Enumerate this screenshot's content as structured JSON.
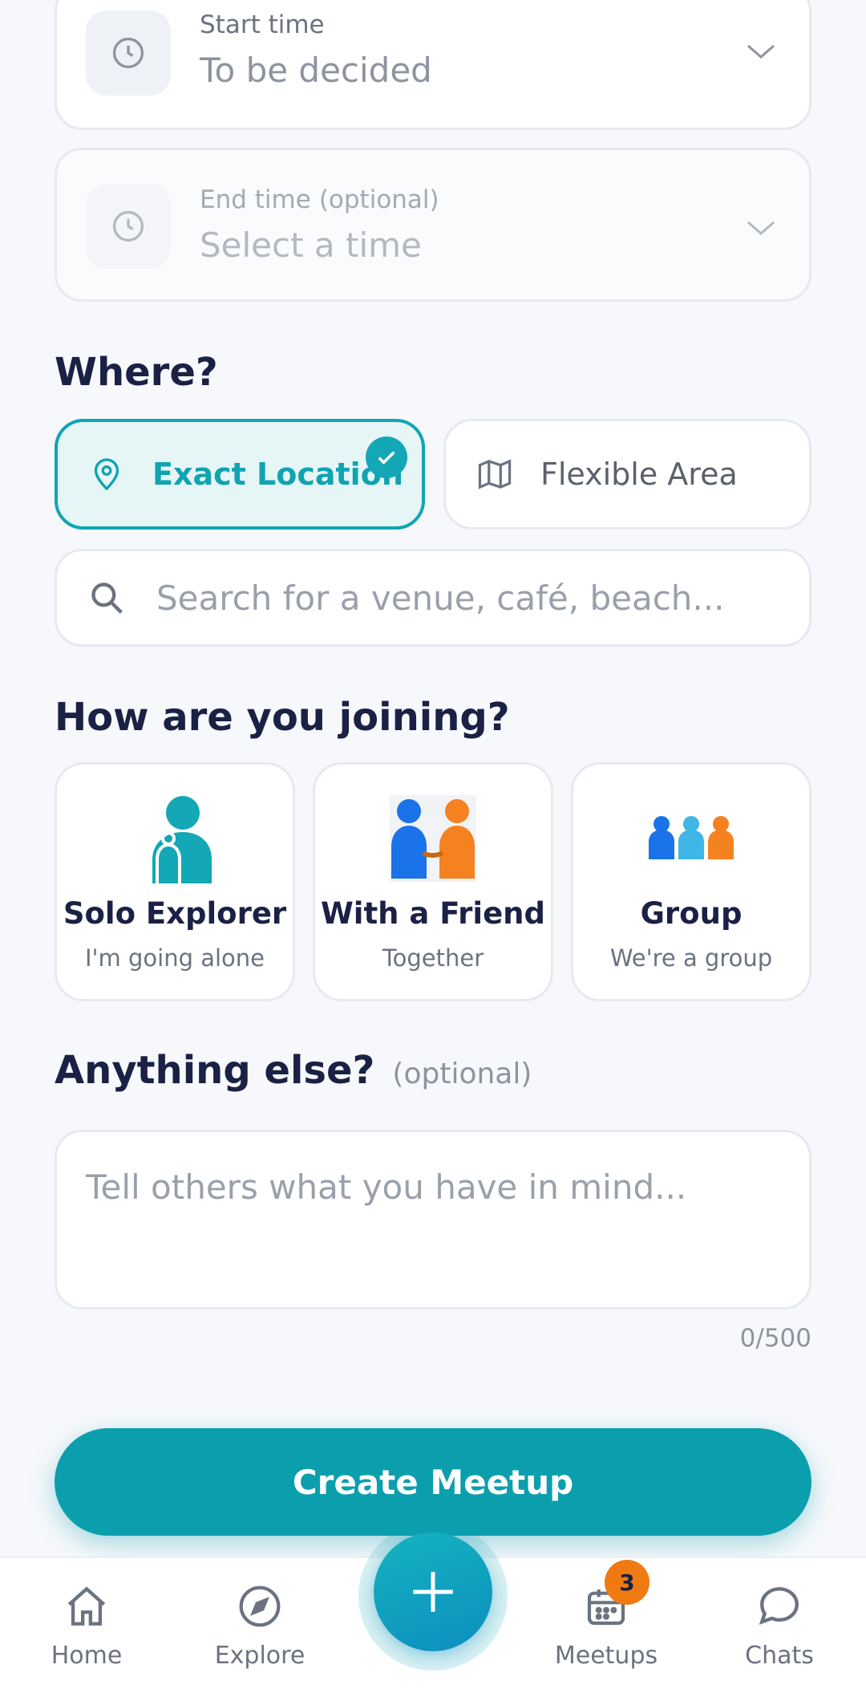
{
  "start_time": {
    "label": "Start time",
    "value": "To be decided"
  },
  "end_time": {
    "label": "End time",
    "optional_label": "(optional)",
    "placeholder": "Select a time"
  },
  "where": {
    "title": "Where?",
    "options": [
      {
        "label": "Exact Location",
        "selected": true
      },
      {
        "label": "Flexible Area",
        "selected": false
      }
    ],
    "search_placeholder": "Search for a venue, café, beach..."
  },
  "joining": {
    "title": "How are you joining?",
    "options": [
      {
        "title": "Solo Explorer",
        "subtitle": "I'm going alone",
        "icon": "solo-person-icon"
      },
      {
        "title": "With a Friend",
        "subtitle": "Together",
        "icon": "two-friends-icon"
      },
      {
        "title": "Group",
        "subtitle": "We're a group",
        "icon": "group-icon"
      }
    ]
  },
  "notes": {
    "title": "Anything else?",
    "optional_label": "(optional)",
    "placeholder": "Tell others what you have in mind...",
    "counter": "0/500"
  },
  "create_button": "Create Meetup",
  "nav": {
    "items": [
      {
        "label": "Home",
        "icon": "home-icon"
      },
      {
        "label": "Explore",
        "icon": "compass-icon"
      },
      {
        "label": "Meetups",
        "icon": "calendar-icon",
        "badge": "3"
      },
      {
        "label": "Chats",
        "icon": "chat-bubble-icon"
      }
    ],
    "fab_icon": "plus-icon"
  },
  "colors": {
    "accent": "#0b9fae",
    "badge": "#f07a12",
    "title": "#1b2145"
  }
}
